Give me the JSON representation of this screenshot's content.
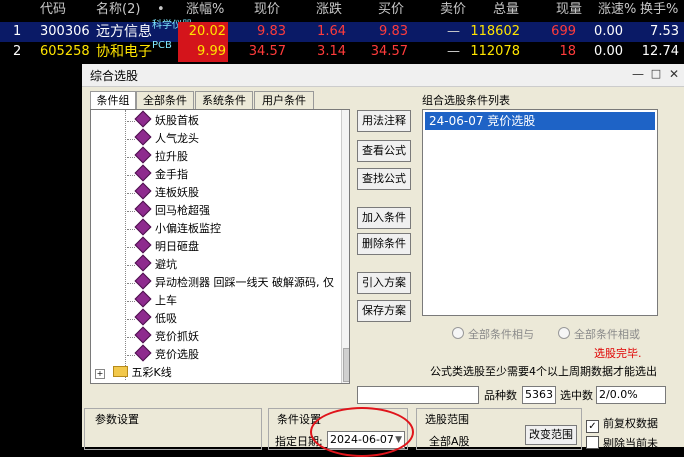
{
  "table": {
    "headers": [
      "代码",
      "名称(2)",
      "•",
      "涨幅%",
      "现价",
      "涨跌",
      "买价",
      "卖价",
      "总量",
      "现量",
      "涨速%",
      "换手%"
    ],
    "rows": [
      {
        "idx": "1",
        "code": "300306",
        "name": "远方信息",
        "tag": "科学仪器",
        "change_pct": "20.02",
        "price": "9.83",
        "change": "1.64",
        "bid": "9.83",
        "ask": "—",
        "volume": "118602",
        "cur_vol": "699",
        "speed": "0.00",
        "turnover": "7.53"
      },
      {
        "idx": "2",
        "code": "605258",
        "name": "协和电子",
        "tag": "PCB",
        "change_pct": "9.99",
        "price": "34.57",
        "change": "3.14",
        "bid": "34.57",
        "ask": "—",
        "volume": "112078",
        "cur_vol": "18",
        "speed": "0.00",
        "turnover": "12.74"
      }
    ]
  },
  "dialog": {
    "title": "综合选股",
    "tabs": [
      "条件组",
      "全部条件",
      "系统条件",
      "用户条件"
    ],
    "tree_items": [
      "妖股首板",
      "人气龙头",
      "拉升股",
      "金手指",
      "连板妖股",
      "回马枪超强",
      "小偏连板监控",
      "明日砸盘",
      "避坑",
      "异动检测器 回踩一线天  破解源码, 仅",
      "上车",
      "低吸",
      "竞价抓妖",
      "竞价选股"
    ],
    "tree_folder": "五彩K线",
    "buttons": [
      "用法注释",
      "查看公式",
      "查找公式",
      "加入条件",
      "删除条件",
      "引入方案",
      "保存方案"
    ],
    "list_title": "组合选股条件列表",
    "list_items": [
      "24-06-07  竞价选股"
    ],
    "radio_all_and": "全部条件相与",
    "radio_all_or": "全部条件相或",
    "status": "选股完毕.",
    "note": "公式类选股至少需要4个以上周期数据才能选出",
    "count_label": "品种数",
    "count_value": "5363",
    "selected_label": "选中数",
    "selected_value": "2/0.0%",
    "param_title": "参数设置",
    "cond_title": "条件设置",
    "date_label": "指定日期:",
    "date_value": "2024-06-07",
    "range_title": "选股范围",
    "range_value": "全部A股",
    "change_range_btn": "改变范围",
    "checkbox_1": "前复权数据",
    "checkbox_2": "剔除当前未"
  },
  "colors": {
    "red": "#ff3b3b",
    "yellow": "#ffe400",
    "cyan": "#7fe7ff",
    "highlight": "#1e63c6"
  }
}
